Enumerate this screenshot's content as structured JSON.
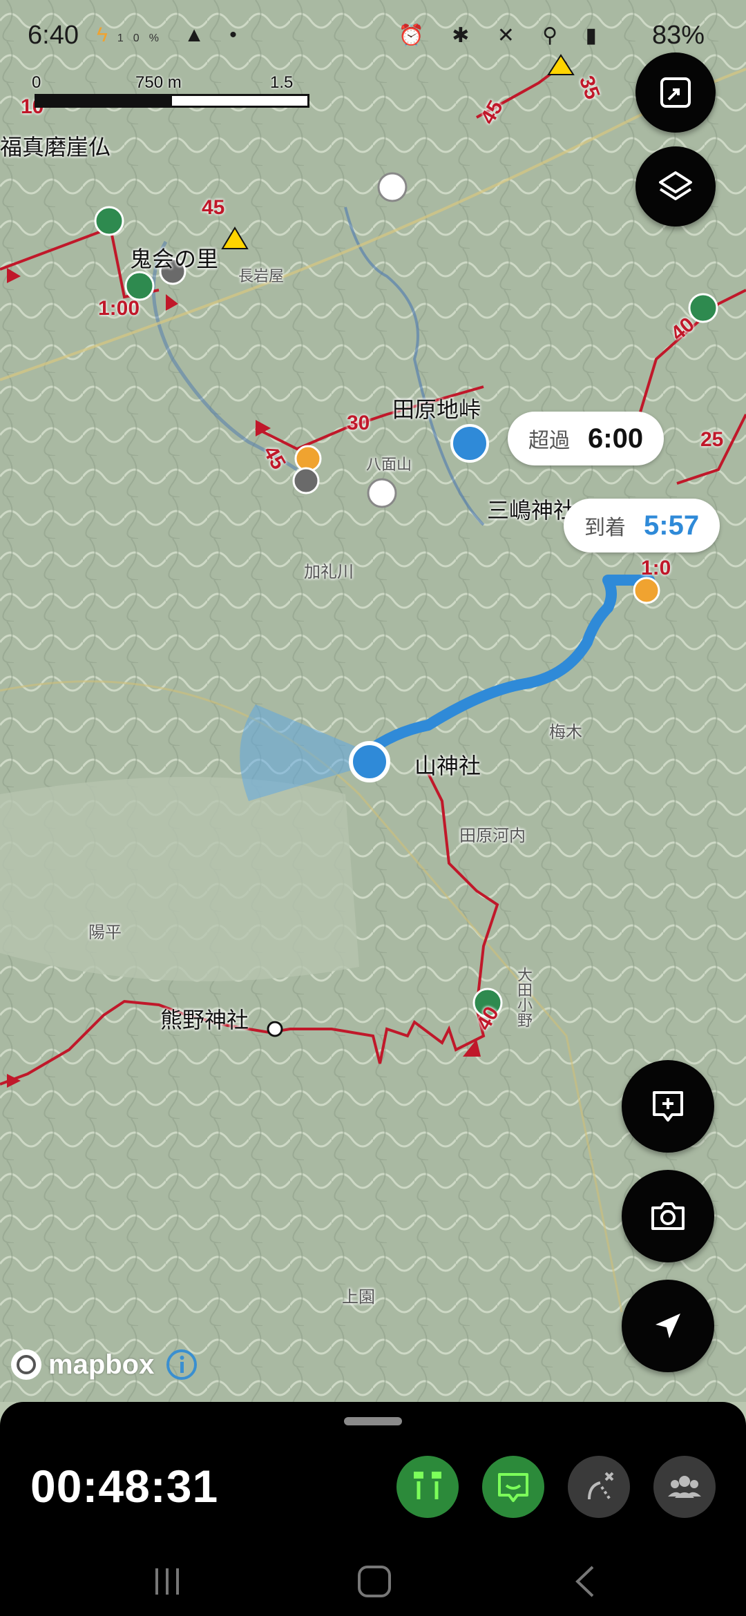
{
  "status_bar": {
    "time": "6:40",
    "battery": "83%",
    "weather_small": "10%"
  },
  "scale": {
    "zero": "0",
    "mid": "750 m",
    "max": "1.5 km"
  },
  "places": {
    "fukuma": "福真磨崖仏",
    "onikai": "鬼会の里",
    "tawara_pass": "田原地峠",
    "mishima": "三嶋神社",
    "yama": "山神社",
    "kumano": "熊野神社",
    "kureigawa": "加礼川",
    "hachimenzan": "八面山",
    "tawara_kawauchi": "田原河内",
    "umeki": "梅木",
    "yohira": "陽平",
    "odaono": "大田小野",
    "kamizono": "上園",
    "choji": "長岩屋"
  },
  "trail_times": [
    "45",
    "1:00",
    "45",
    "30",
    "40",
    "25",
    "40",
    "45",
    "35",
    "10",
    "1:0"
  ],
  "bubbles": {
    "pass": {
      "key": "超過",
      "value": "6:00"
    },
    "arrive": {
      "key": "到着",
      "value": "5:57"
    }
  },
  "attribution": "mapbox",
  "bottom_bar": {
    "timer": "00:48:31"
  },
  "colors": {
    "route_blue": "#2f8ad8",
    "trail_red": "#c0182a",
    "accent_green": "#2c8a3a"
  }
}
